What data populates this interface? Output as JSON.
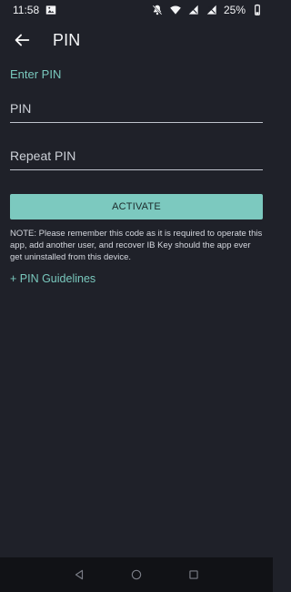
{
  "status_bar": {
    "time": "11:58",
    "battery": "25%",
    "icons": [
      "image-icon",
      "notifications-off-icon",
      "wifi-icon",
      "signal-icon",
      "signal-icon",
      "battery-icon"
    ]
  },
  "app_bar": {
    "title": "PIN",
    "back_icon": "arrow-left-icon"
  },
  "form": {
    "section_label": "Enter PIN",
    "pin_placeholder": "PIN",
    "repeat_pin_placeholder": "Repeat PIN",
    "activate_label": "ACTIVATE"
  },
  "note": {
    "text": "NOTE: Please remember this code as it is required to operate this app, add another user, and recover IB Key should the app ever get uninstalled from this device."
  },
  "link": {
    "pin_guidelines": "+ PIN Guidelines"
  },
  "nav_bar": {
    "buttons": [
      "back-nav-icon",
      "home-nav-icon",
      "recents-nav-icon"
    ]
  },
  "theme": {
    "background": "#1f2129",
    "accent": "#7cc9bf",
    "text": "#e7e9ee",
    "nav_background": "#111216"
  }
}
